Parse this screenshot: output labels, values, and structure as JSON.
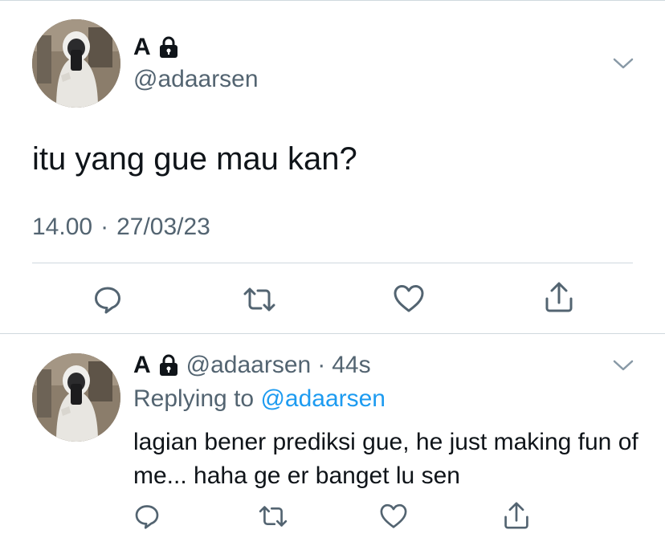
{
  "main_tweet": {
    "display_name": "A",
    "handle": "@adaarsen",
    "text": "itu yang gue mau kan?",
    "time": "14.00",
    "separator": "·",
    "date": "27/03/23",
    "icons": {
      "lock": "lock-icon",
      "chevron": "chevron-down-icon",
      "reply": "comment-icon",
      "retweet": "retweet-icon",
      "like": "heart-icon",
      "share": "share-icon"
    }
  },
  "reply_tweet": {
    "display_name": "A",
    "handle": "@adaarsen",
    "separator": "·",
    "age": "44s",
    "replying_prefix": "Replying to",
    "replying_to": "@adaarsen",
    "text": "lagian bener prediksi gue, he just making fun of me... haha ge er banget lu sen"
  },
  "colors": {
    "text": "#0f1419",
    "secondary": "#536471",
    "link": "#1d9bf0",
    "divider": "#cfd9de"
  }
}
